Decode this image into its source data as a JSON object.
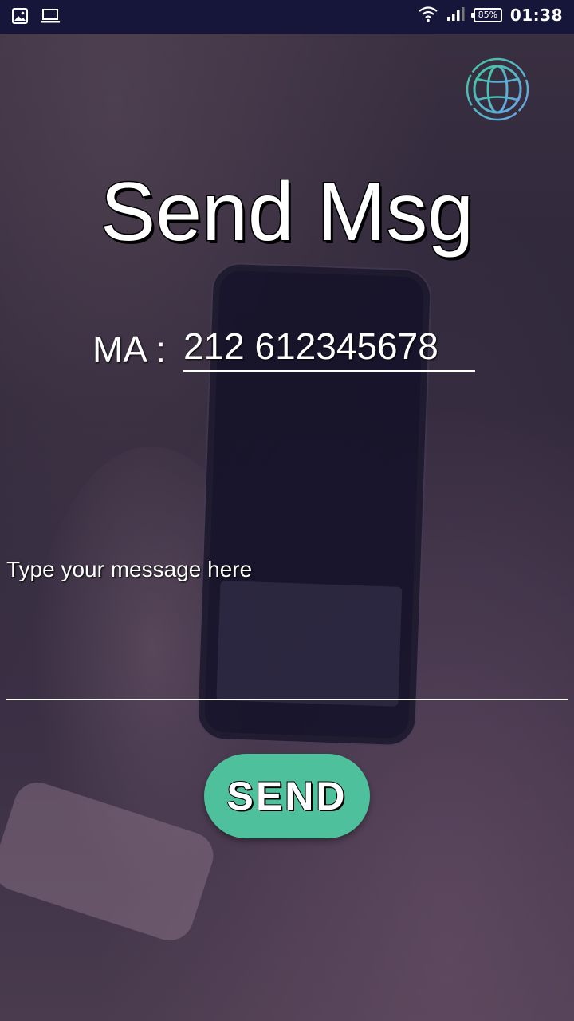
{
  "status_bar": {
    "battery_level": "85%",
    "time": "01:38",
    "left_icons": [
      "gallery-icon",
      "laptop-icon"
    ],
    "right_icons": [
      "wifi-icon",
      "signal-icon",
      "battery-icon"
    ]
  },
  "globe_button": {
    "icon": "globe-icon",
    "colors": {
      "ring_start": "#3ec9a0",
      "ring_end": "#6ba3e8"
    }
  },
  "title": "Send Msg",
  "phone": {
    "country_code": "MA :",
    "value": "212 612345678"
  },
  "message": {
    "placeholder": "Type your message here",
    "value": ""
  },
  "send_button": {
    "label": "SEND",
    "color": "#4ec09c"
  }
}
